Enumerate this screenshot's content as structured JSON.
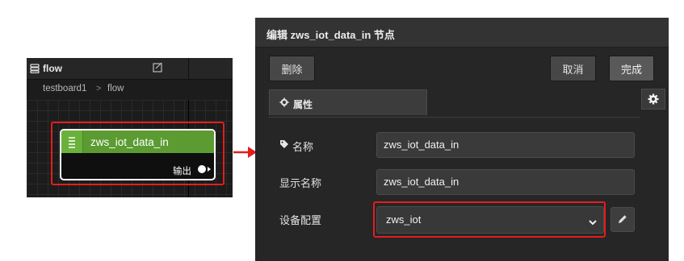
{
  "flow_panel": {
    "tab_title": "flow",
    "breadcrumb": [
      "testboard1",
      "flow"
    ],
    "node": {
      "label": "zws_iot_data_in",
      "output_label": "输出",
      "color": "#5b9b32"
    }
  },
  "editor": {
    "title": "编辑 zws_iot_data_in 节点",
    "buttons": {
      "delete": "删除",
      "cancel": "取消",
      "done": "完成"
    },
    "tabs": [
      {
        "label": "属性",
        "icon": "gear-icon"
      }
    ],
    "fields": {
      "name": {
        "label": "名称",
        "value": "zws_iot_data_in",
        "icon": "tag-icon"
      },
      "display_name": {
        "label": "显示名称",
        "value": "zws_iot_data_in"
      },
      "device_config": {
        "label": "设备配置",
        "selected": "zws_iot"
      }
    }
  },
  "highlight_color": "#e41d1d"
}
